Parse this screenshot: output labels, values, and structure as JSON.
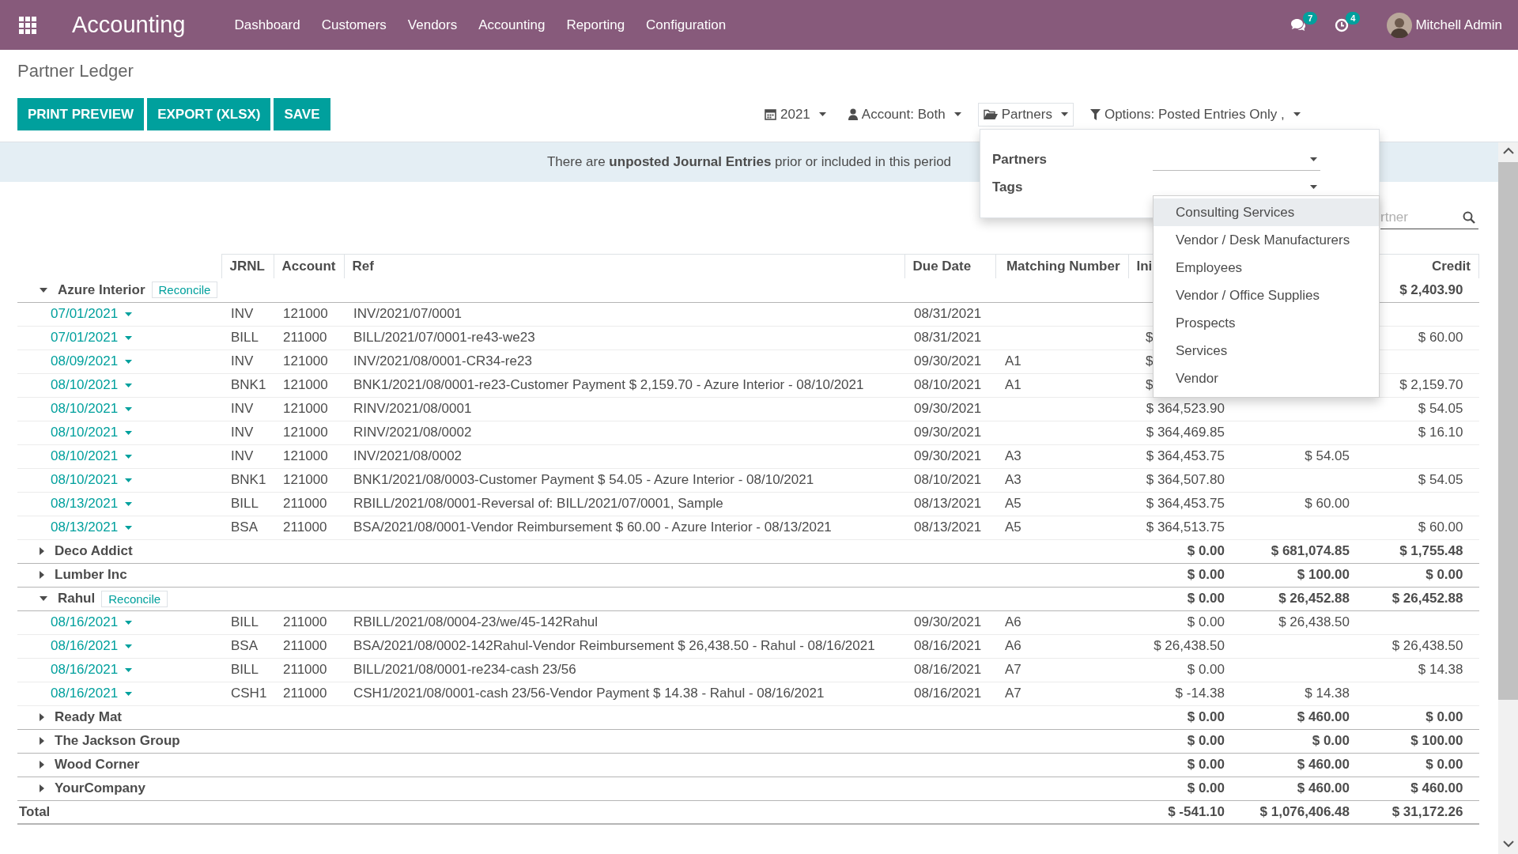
{
  "navbar": {
    "app": "Accounting",
    "menu": [
      "Dashboard",
      "Customers",
      "Vendors",
      "Accounting",
      "Reporting",
      "Configuration"
    ],
    "messages_badge": "7",
    "activities_badge": "4",
    "user": "Mitchell Admin"
  },
  "page_title": "Partner Ledger",
  "buttons": [
    "PRINT PREVIEW",
    "EXPORT (XLSX)",
    "SAVE"
  ],
  "filters": [
    {
      "kind": "calendar",
      "label": "2021",
      "open": false
    },
    {
      "kind": "user",
      "label": "Account: Both",
      "open": false
    },
    {
      "kind": "folder",
      "label": "Partners",
      "open": true
    },
    {
      "kind": "funnel",
      "label": "Options: Posted Entries Only ,",
      "open": false
    }
  ],
  "alert": "There are **unposted Journal Entries** prior or included in this period",
  "partner_panel": {
    "fields": [
      {
        "label": "Partners"
      },
      {
        "label": "Tags"
      }
    ],
    "tag_options": [
      {
        "label": "Consulting Services",
        "selected": true
      },
      {
        "label": "Vendor / Desk Manufacturers",
        "selected": false
      },
      {
        "label": "Employees",
        "selected": false
      },
      {
        "label": "Vendor / Office Supplies",
        "selected": false
      },
      {
        "label": "Prospects",
        "selected": false
      },
      {
        "label": "Services",
        "selected": false
      },
      {
        "label": "Vendor",
        "selected": false
      }
    ]
  },
  "search": {
    "placeholder": "rtner"
  },
  "table": {
    "columns": [
      {
        "label": "JRNL"
      },
      {
        "label": "Account"
      },
      {
        "label": "Ref"
      },
      {
        "label": "Due Date"
      },
      {
        "label": "Matching Number"
      },
      {
        "label": "Ini"
      },
      {
        "label": "Credit"
      }
    ],
    "groups": [
      {
        "name": "Azure Interior",
        "expanded": true,
        "reconcile": "Reconcile",
        "credit": "$ 2,403.90",
        "lines": [
          {
            "date": "07/01/2021",
            "jrnl": "INV",
            "account": "121000",
            "ref": "INV/2021/07/0001",
            "due": "08/31/2021"
          },
          {
            "date": "07/01/2021",
            "jrnl": "BILL",
            "account": "211000",
            "ref": "BILL/2021/07/0001-re43-we23",
            "due": "08/31/2021",
            "initial": "$",
            "initial_covered": true,
            "credit": "$ 60.00"
          },
          {
            "date": "08/09/2021",
            "jrnl": "INV",
            "account": "121000",
            "ref": "INV/2021/08/0001-CR34-re23",
            "due": "09/30/2021",
            "match": "A1",
            "initial": "$",
            "initial_covered": true
          },
          {
            "date": "08/10/2021",
            "jrnl": "BNK1",
            "account": "121000",
            "ref": "BNK1/2021/08/0001-re23-Customer Payment $ 2,159.70 - Azure Interior - 08/10/2021",
            "due": "08/10/2021",
            "match": "A1",
            "initial": "$",
            "initial_covered": true,
            "credit": "$ 2,159.70"
          },
          {
            "date": "08/10/2021",
            "jrnl": "INV",
            "account": "121000",
            "ref": "RINV/2021/08/0001",
            "due": "09/30/2021",
            "initial": "$ 364,523.90",
            "credit": "$ 54.05"
          },
          {
            "date": "08/10/2021",
            "jrnl": "INV",
            "account": "121000",
            "ref": "RINV/2021/08/0002",
            "due": "09/30/2021",
            "initial": "$ 364,469.85",
            "credit": "$ 16.10"
          },
          {
            "date": "08/10/2021",
            "jrnl": "INV",
            "account": "121000",
            "ref": "INV/2021/08/0002",
            "due": "09/30/2021",
            "match": "A3",
            "initial": "$ 364,453.75",
            "debit": "$ 54.05"
          },
          {
            "date": "08/10/2021",
            "jrnl": "BNK1",
            "account": "121000",
            "ref": "BNK1/2021/08/0003-Customer Payment $ 54.05 - Azure Interior - 08/10/2021",
            "due": "08/10/2021",
            "match": "A3",
            "initial": "$ 364,507.80",
            "credit": "$ 54.05"
          },
          {
            "date": "08/13/2021",
            "jrnl": "BILL",
            "account": "211000",
            "ref": "RBILL/2021/08/0001-Reversal of: BILL/2021/07/0001, Sample",
            "due": "08/13/2021",
            "match": "A5",
            "initial": "$ 364,453.75",
            "debit": "$ 60.00"
          },
          {
            "date": "08/13/2021",
            "jrnl": "BSA",
            "account": "211000",
            "ref": "BSA/2021/08/0001-Vendor Reimbursement $ 60.00 - Azure Interior - 08/13/2021",
            "due": "08/13/2021",
            "match": "A5",
            "initial": "$ 364,513.75",
            "credit": "$ 60.00"
          }
        ]
      },
      {
        "name": "Deco Addict",
        "expanded": false,
        "initial": "$ 0.00",
        "debit": "$ 681,074.85",
        "credit": "$ 1,755.48"
      },
      {
        "name": "Lumber Inc",
        "expanded": false,
        "initial": "$ 0.00",
        "debit": "$ 100.00",
        "credit": "$ 0.00"
      },
      {
        "name": "Rahul",
        "expanded": true,
        "reconcile": "Reconcile",
        "initial": "$ 0.00",
        "debit": "$ 26,452.88",
        "credit": "$ 26,452.88",
        "lines": [
          {
            "date": "08/16/2021",
            "jrnl": "BILL",
            "account": "211000",
            "ref": "RBILL/2021/08/0004-23/we/45-142Rahul",
            "due": "09/30/2021",
            "match": "A6",
            "initial": "$ 0.00",
            "debit": "$ 26,438.50"
          },
          {
            "date": "08/16/2021",
            "jrnl": "BSA",
            "account": "211000",
            "ref": "BSA/2021/08/0002-142Rahul-Vendor Reimbursement $ 26,438.50 - Rahul - 08/16/2021",
            "due": "08/16/2021",
            "match": "A6",
            "initial": "$ 26,438.50",
            "credit": "$ 26,438.50"
          },
          {
            "date": "08/16/2021",
            "jrnl": "BILL",
            "account": "211000",
            "ref": "BILL/2021/08/0001-re234-cash 23/56",
            "due": "08/16/2021",
            "match": "A7",
            "initial": "$ 0.00",
            "credit": "$ 14.38"
          },
          {
            "date": "08/16/2021",
            "jrnl": "CSH1",
            "account": "211000",
            "ref": "CSH1/2021/08/0001-cash 23/56-Vendor Payment $ 14.38 - Rahul - 08/16/2021",
            "due": "08/16/2021",
            "match": "A7",
            "initial": "$ -14.38",
            "debit": "$ 14.38"
          }
        ]
      },
      {
        "name": "Ready Mat",
        "expanded": false,
        "initial": "$ 0.00",
        "debit": "$ 460.00",
        "credit": "$ 0.00"
      },
      {
        "name": "The Jackson Group",
        "expanded": false,
        "initial": "$ 0.00",
        "debit": "$ 0.00",
        "credit": "$ 100.00"
      },
      {
        "name": "Wood Corner",
        "expanded": false,
        "initial": "$ 0.00",
        "debit": "$ 460.00",
        "credit": "$ 0.00"
      },
      {
        "name": "YourCompany",
        "expanded": false,
        "initial": "$ 0.00",
        "debit": "$ 460.00",
        "credit": "$ 460.00"
      }
    ],
    "total": {
      "label": "Total",
      "initial": "$ -541.10",
      "debit": "$ 1,076,406.48",
      "credit": "$ 31,172.26"
    }
  }
}
